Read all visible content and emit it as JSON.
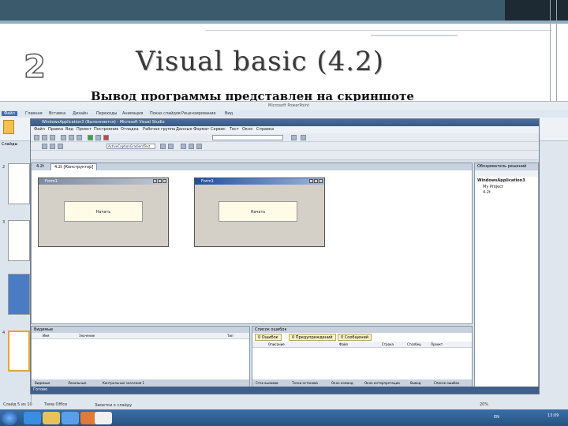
{
  "slide": {
    "number": "2",
    "title": "Visual basic (4.2)",
    "subtitle": "Вывод программы представлен на скриншоте"
  },
  "powerpoint": {
    "title": "Microsoft PowerPoint",
    "tabs": [
      "Файл",
      "Главная",
      "Вставка",
      "Дизайн",
      "Переходы",
      "Анимация",
      "Показ слайдов",
      "Рецензирование",
      "Вид"
    ],
    "panel_label": "Слайды",
    "slide_numbers": [
      "2",
      "3",
      "4"
    ],
    "status": "Заметки к слайду"
  },
  "vs": {
    "title": "WindowsApplication3 (Выполняется) - Microsoft Visual Studio",
    "menu": [
      "Файл",
      "Правка",
      "Вид",
      "Проект",
      "Построение",
      "Отладка",
      "Рабочая группа",
      "Данные",
      "Формат",
      "Сервис",
      "Тест",
      "Окно",
      "Справка"
    ],
    "combo": "ActiveCaptionGradientText",
    "doc_tabs": [
      "4.2t",
      "4.2t [Конструктор]"
    ],
    "form_left": {
      "title": "Form1",
      "button": "Начать"
    },
    "form_right": {
      "title": "Form1",
      "button": "Начать"
    },
    "solution": {
      "header": "Обозреватель решений",
      "items": [
        "WindowsApplication3",
        "My Project",
        "4.2t"
      ]
    },
    "output": {
      "header": "Видимые",
      "cols": [
        "Имя",
        "Значение",
        "Тип"
      ]
    },
    "output_tabs": [
      "Видимые",
      "Локальные",
      "Контрольные значения 1"
    ],
    "errors": {
      "header": "Список ошибок",
      "filters": [
        "0 Ошибок",
        "0 Предупреждений",
        "0 Сообщений"
      ],
      "cols": [
        "Описание",
        "Файл",
        "Строка",
        "Столбец",
        "Проект"
      ],
      "tabs": [
        "Стек вызовов",
        "Точки останова",
        "Окно команд",
        "Окно интерпретации",
        "Вывод",
        "Список ошибок"
      ]
    },
    "status": "Готово"
  },
  "taskbar": {
    "items": [
      "Слайд 5 из 10",
      "Тема Office"
    ],
    "zoom": "20%",
    "lang": "EN",
    "time": "13:09"
  }
}
